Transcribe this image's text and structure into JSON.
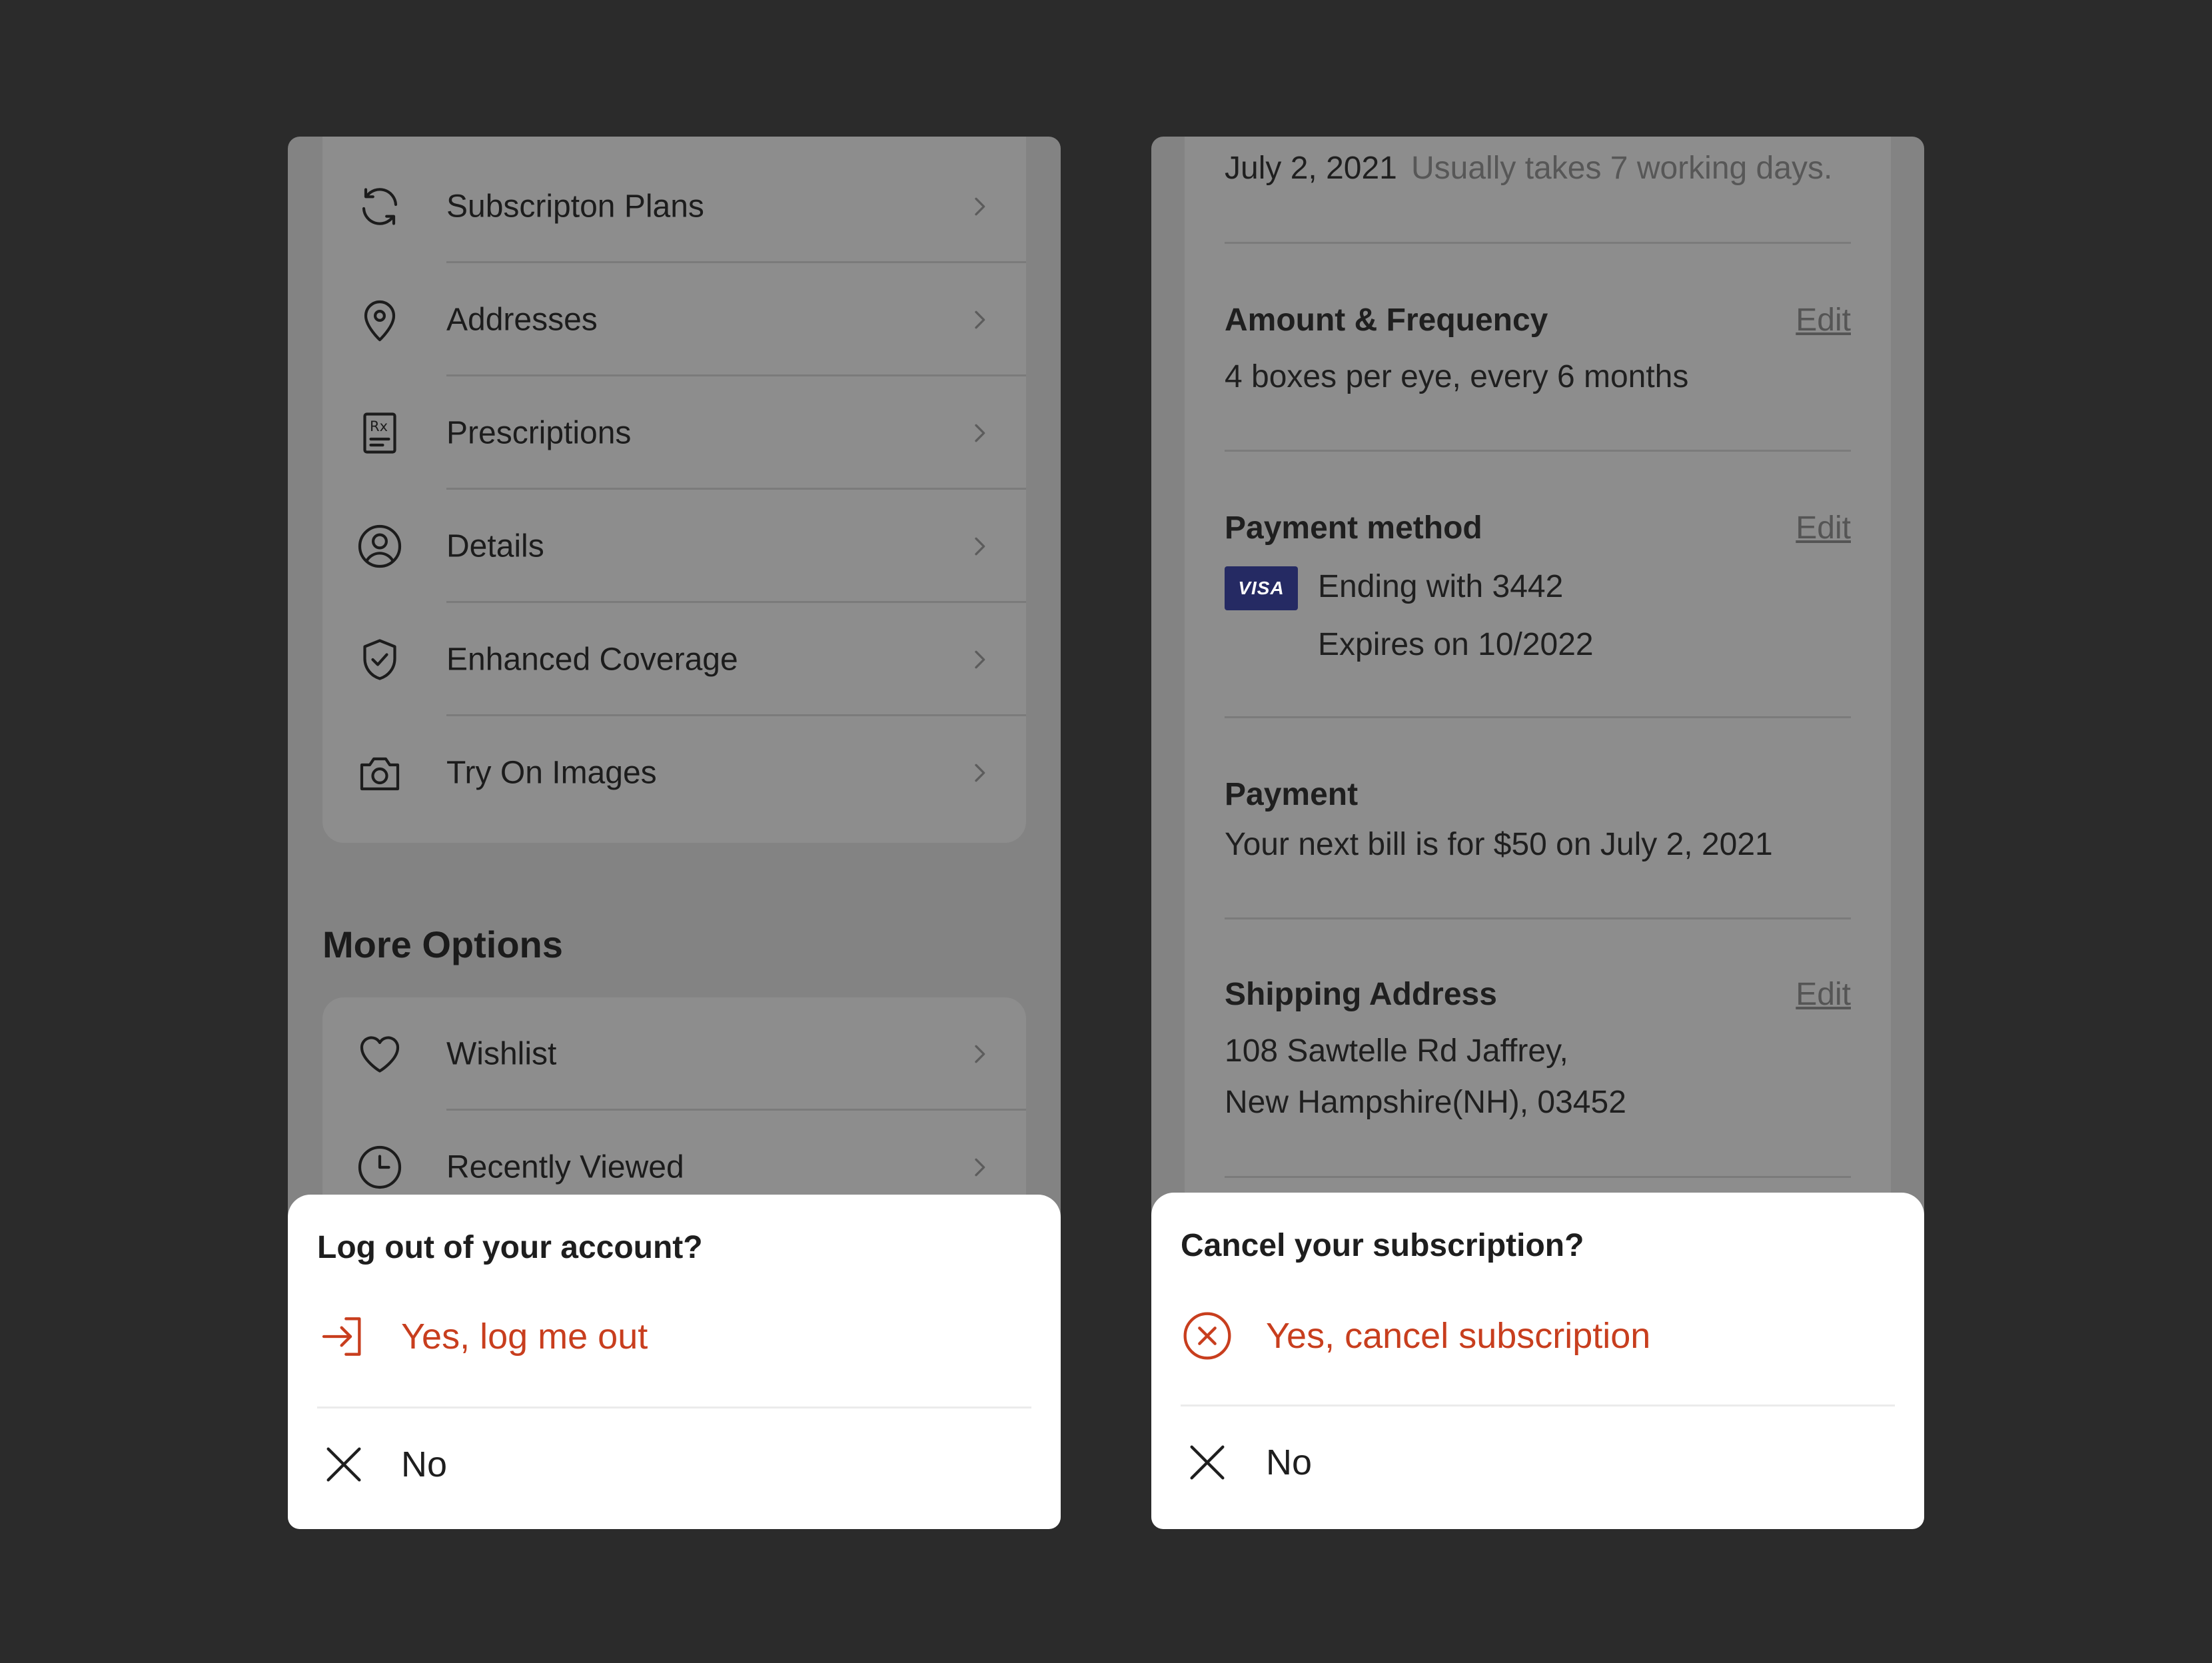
{
  "left_screen": {
    "account_menu": [
      {
        "label": "Subscripton Plans",
        "icon": "refresh-icon"
      },
      {
        "label": "Addresses",
        "icon": "location-pin-icon"
      },
      {
        "label": "Prescriptions",
        "icon": "prescription-icon"
      },
      {
        "label": "Details",
        "icon": "user-circle-icon"
      },
      {
        "label": "Enhanced Coverage",
        "icon": "shield-check-icon"
      },
      {
        "label": "Try On Images",
        "icon": "camera-icon"
      }
    ],
    "more_options_title": "More Options",
    "more_options": [
      {
        "label": "Wishlist",
        "icon": "heart-icon"
      },
      {
        "label": "Recently Viewed",
        "icon": "clock-icon"
      }
    ],
    "sheet": {
      "title": "Log out of your account?",
      "confirm_label": "Yes, log me out",
      "cancel_label": "No"
    }
  },
  "right_screen": {
    "delivery": {
      "date": "July 2, 2021",
      "note": "Usually takes 7 working days."
    },
    "amount_frequency": {
      "title": "Amount & Frequency",
      "edit_label": "Edit",
      "value": "4 boxes per eye, every 6 months"
    },
    "payment_method": {
      "title": "Payment method",
      "edit_label": "Edit",
      "card_brand": "VISA",
      "ending": "Ending with 3442",
      "expires": "Expires on 10/2022"
    },
    "payment": {
      "title": "Payment",
      "value": "Your next bill is for $50 on July 2, 2021"
    },
    "shipping_address": {
      "title": "Shipping Address",
      "edit_label": "Edit",
      "line1": "108 Sawtelle Rd Jaffrey,",
      "line2": "New Hampshire(NH), 03452"
    },
    "sheet": {
      "title": "Cancel your subscription?",
      "confirm_label": "Yes, cancel subscription",
      "cancel_label": "No"
    }
  },
  "colors": {
    "background": "#2b2b2b",
    "overlay_screen": "#838383",
    "danger": "#c83e1e",
    "visa": "#252a63",
    "sheet": "#ffffff"
  }
}
